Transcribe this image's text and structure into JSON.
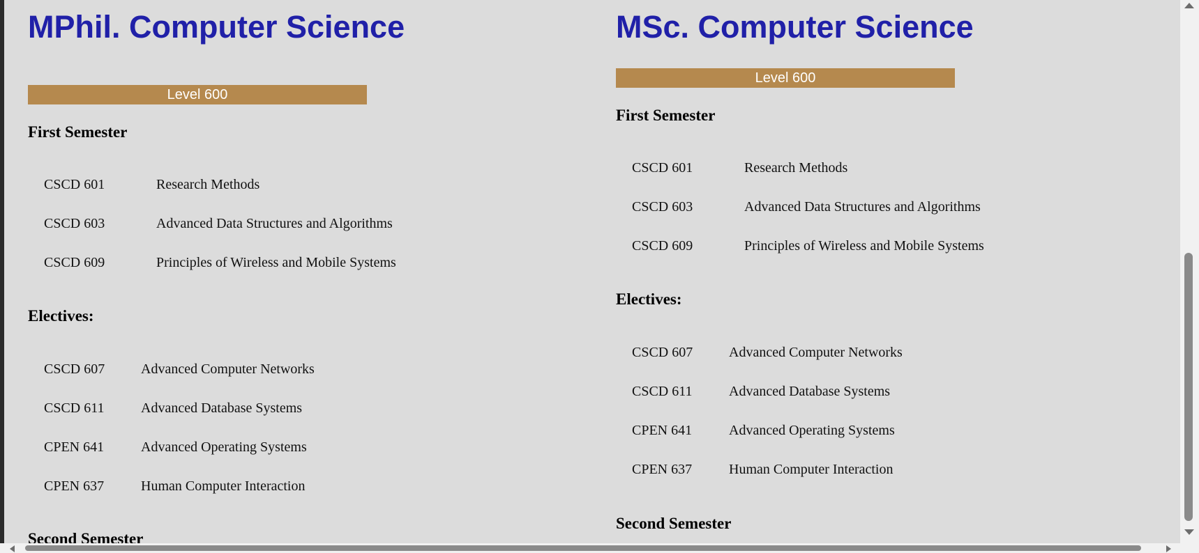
{
  "left_program": {
    "title": "MPhil. Computer Science",
    "level": "Level 600",
    "first_semester_heading": "First Semester",
    "first_semester_courses": [
      {
        "code": "CSCD 601",
        "name": "Research Methods"
      },
      {
        "code": "CSCD 603",
        "name": "Advanced Data Structures and Algorithms"
      },
      {
        "code": "CSCD 609",
        "name": "Principles of Wireless and Mobile Systems"
      }
    ],
    "electives_heading": "Electives:",
    "electives": [
      {
        "code": "CSCD 607",
        "name": "Advanced Computer Networks"
      },
      {
        "code": "CSCD 611",
        "name": "Advanced Database Systems"
      },
      {
        "code": "CPEN 641",
        "name": "Advanced Operating Systems"
      },
      {
        "code": "CPEN 637",
        "name": "Human Computer Interaction"
      }
    ],
    "second_semester_heading": "Second Semester"
  },
  "right_program": {
    "title": "MSc. Computer Science",
    "level": "Level 600",
    "first_semester_heading": "First Semester",
    "first_semester_courses": [
      {
        "code": "CSCD 601",
        "name": "Research Methods"
      },
      {
        "code": "CSCD 603",
        "name": "Advanced Data Structures and Algorithms"
      },
      {
        "code": "CSCD 609",
        "name": "Principles of Wireless and Mobile Systems"
      }
    ],
    "electives_heading": "Electives:",
    "electives": [
      {
        "code": "CSCD 607",
        "name": "Advanced Computer Networks"
      },
      {
        "code": "CSCD 611",
        "name": "Advanced Database Systems"
      },
      {
        "code": "CPEN 641",
        "name": "Advanced Operating Systems"
      },
      {
        "code": "CPEN 637",
        "name": "Human Computer Interaction"
      }
    ],
    "second_semester_heading": "Second Semester"
  },
  "colors": {
    "title": "#2020a8",
    "level_bar": "#b5894e",
    "page_background": "#dcdcdc"
  }
}
